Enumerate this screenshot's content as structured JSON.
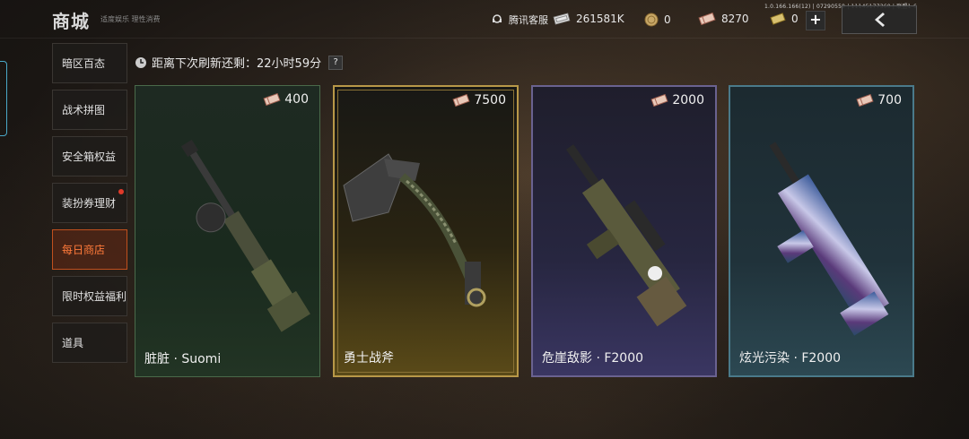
{
  "header": {
    "title": "商城",
    "subtitle": "适度娱乐 理性消费",
    "version": "1.0.166.166(12) | 07290559 | 11145177360 | 联盟1-6",
    "service": "腾讯客服",
    "currency_bills": "261581K",
    "currency_coins": "0",
    "currency_vouchers": "8270",
    "currency_gold": "0"
  },
  "sidebar": {
    "items": [
      {
        "label": "暗区百态"
      },
      {
        "label": "战术拼图"
      },
      {
        "label": "安全箱权益"
      },
      {
        "label": "装扮券理财"
      },
      {
        "label": "每日商店"
      },
      {
        "label": "限时权益福利"
      },
      {
        "label": "道具"
      }
    ]
  },
  "timer": {
    "text": "距离下次刷新还剩：22小时59分",
    "help": "?"
  },
  "cards": [
    {
      "name": "脏脏 · Suomi",
      "price": "400"
    },
    {
      "name": "勇士战斧",
      "price": "7500"
    },
    {
      "name": "危崖敌影 · F2000",
      "price": "2000"
    },
    {
      "name": "炫光污染 · F2000",
      "price": "700"
    }
  ],
  "colors": {
    "accent": "#ff7a3a",
    "gold_border": "#b89848",
    "purple_border": "#6a6290",
    "teal_border": "#4a7a8a",
    "green_border": "#4a6a4a"
  }
}
